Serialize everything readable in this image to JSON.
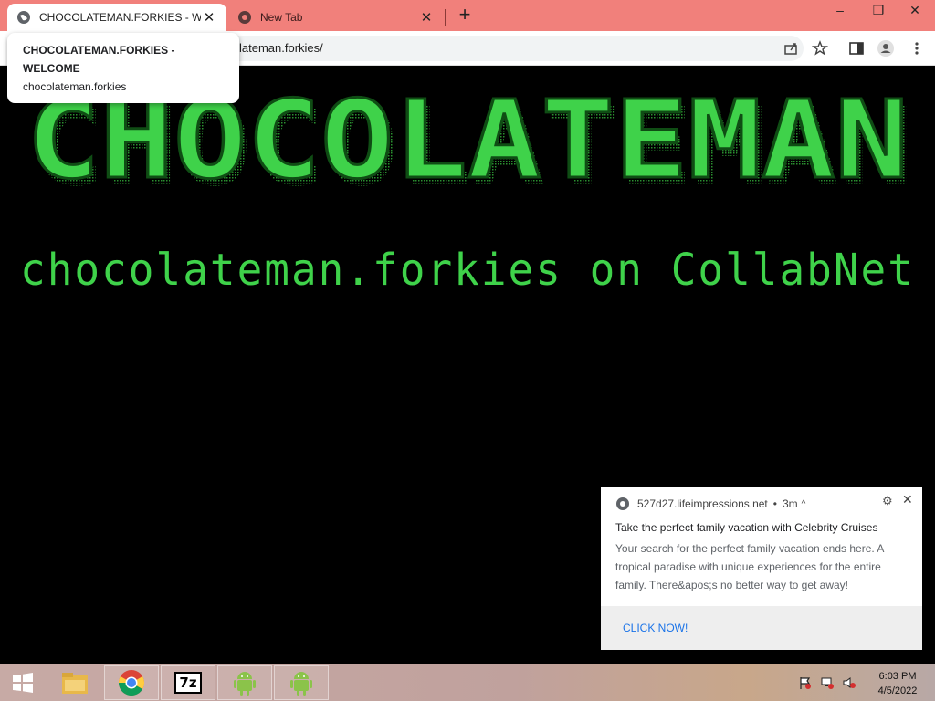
{
  "browser": {
    "tabs": [
      {
        "title": "CHOCOLATEMAN.FORKIES - WELCOME",
        "active": true
      },
      {
        "title": "New Tab",
        "active": false
      }
    ],
    "url": "lateman.forkies/",
    "hovercard": {
      "title": "CHOCOLATEMAN.FORKIES - WELCOME",
      "domain": "chocolateman.forkies"
    }
  },
  "page": {
    "banner_text": "CHOCOLATEMAN",
    "subtitle": "chocolateman.forkies on CollabNet",
    "accent_color": "#3fd24a"
  },
  "notification": {
    "source": "527d27.lifeimpressions.net",
    "time": "3m",
    "title": "Take the perfect family vacation with Celebrity Cruises",
    "body": "Your search for the perfect family vacation ends here. A tropical paradise with unique experiences for the entire family. There&apos;s no better way to get away!",
    "action": "CLICK NOW!"
  },
  "taskbar": {
    "apps": [
      "windows-start",
      "file-explorer",
      "chrome",
      "7zip",
      "android",
      "android"
    ],
    "seven_zip_label": "7z",
    "time": "6:03 PM",
    "date": "4/5/2022"
  }
}
